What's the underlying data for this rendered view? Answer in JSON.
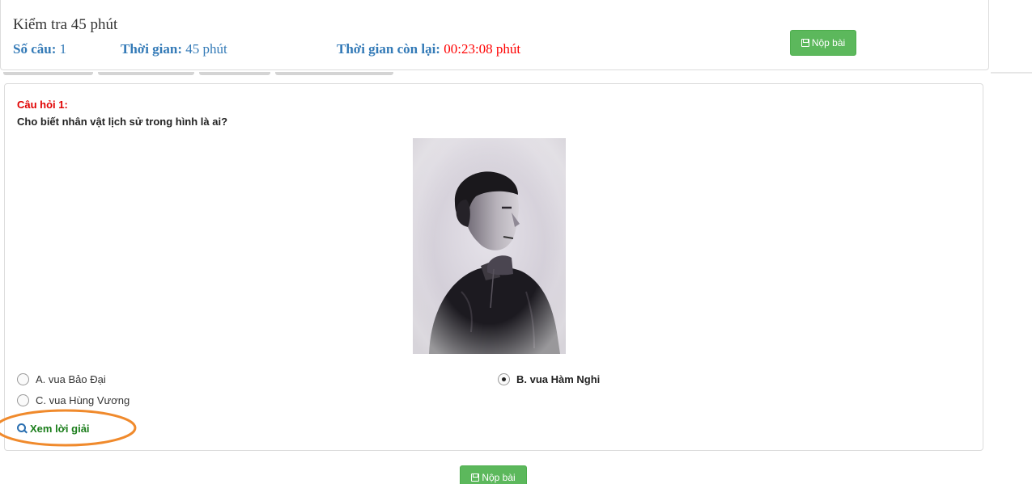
{
  "header": {
    "exam_title": "Kiểm tra 45 phút",
    "count_label": "Số câu:",
    "count_value": "1",
    "time_label": "Thời gian:",
    "time_value": "45 phút",
    "remaining_label": "Thời gian còn lại:",
    "remaining_value": "00:23:08 phút",
    "submit_label": "Nộp bài"
  },
  "question": {
    "label": "Câu hỏi 1:",
    "text": "Cho biết nhân vật lịch sử trong hình là ai?",
    "image_alt": "portrait-photo",
    "options": [
      {
        "label": "A. vua Bảo Đại",
        "selected": false
      },
      {
        "label": "B. vua Hàm Nghi",
        "selected": true
      },
      {
        "label": "C. vua Hùng Vương",
        "selected": false
      }
    ],
    "solution_label": "Xem lời giải"
  },
  "footer": {
    "submit_label": "Nộp bài"
  },
  "colors": {
    "accent_blue": "#337ab7",
    "countdown_red": "#ff0000",
    "question_label_red": "#e00000",
    "submit_green": "#5cb85c",
    "solution_green": "#1a7d1a",
    "highlight_orange": "#f08a2c"
  },
  "icons": {
    "submit": "save-icon",
    "solution": "search-icon",
    "radio_selected": "radio-checked-icon",
    "radio_unselected": "radio-unchecked-icon"
  }
}
